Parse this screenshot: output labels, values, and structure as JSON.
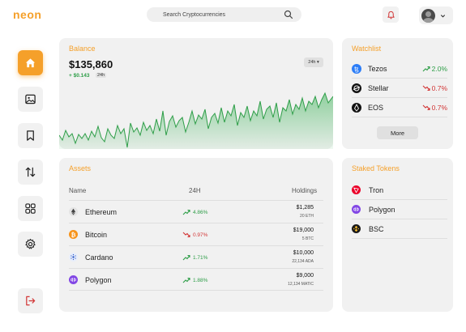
{
  "header": {
    "logo": "neon",
    "search_placeholder": "Search Cryptocurrencies"
  },
  "sidebar": {
    "items": [
      {
        "name": "home-icon",
        "active": true
      },
      {
        "name": "image-icon",
        "active": false
      },
      {
        "name": "bookmark-icon",
        "active": false
      },
      {
        "name": "transfer-icon",
        "active": false
      },
      {
        "name": "grid-icon",
        "active": false
      },
      {
        "name": "gear-icon",
        "active": false
      },
      {
        "name": "logout-icon",
        "active": false
      }
    ]
  },
  "balance": {
    "title": "Balance",
    "value": "$135,860",
    "change": "+ $0.143",
    "period": "24h",
    "range_button": "24h ▾"
  },
  "watchlist": {
    "title": "Watchlist",
    "items": [
      {
        "name": "Tezos",
        "change": "2.0%",
        "direction": "up",
        "icon": "tezos-icon"
      },
      {
        "name": "Stellar",
        "change": "0.7%",
        "direction": "down",
        "icon": "stellar-icon"
      },
      {
        "name": "EOS",
        "change": "0.7%",
        "direction": "down",
        "icon": "eos-icon"
      }
    ],
    "more_label": "More"
  },
  "assets": {
    "title": "Assets",
    "columns": [
      "Name",
      "24H",
      "Holdings"
    ],
    "rows": [
      {
        "name": "Ethereum",
        "change": "4.86%",
        "direction": "up",
        "holding": "$1,285",
        "amount": "20 ETH",
        "icon": "ethereum-icon"
      },
      {
        "name": "Bitcoin",
        "change": "0.97%",
        "direction": "down",
        "holding": "$19,000",
        "amount": "5 BTC",
        "icon": "bitcoin-icon"
      },
      {
        "name": "Cardano",
        "change": "1.71%",
        "direction": "up",
        "holding": "$10,000",
        "amount": "22,134 ADA",
        "icon": "cardano-icon"
      },
      {
        "name": "Polygon",
        "change": "1.88%",
        "direction": "up",
        "holding": "$9,000",
        "amount": "12,134 MATIC",
        "icon": "polygon-icon"
      }
    ]
  },
  "staked": {
    "title": "Staked Tokens",
    "items": [
      {
        "name": "Tron",
        "icon": "tron-icon"
      },
      {
        "name": "Polygon",
        "icon": "polygon-icon"
      },
      {
        "name": "BSC",
        "icon": "bsc-icon"
      }
    ]
  },
  "colors": {
    "accent": "#f5a02a",
    "up": "#2e9e48",
    "down": "#d23535",
    "card": "#f1f1f1"
  }
}
